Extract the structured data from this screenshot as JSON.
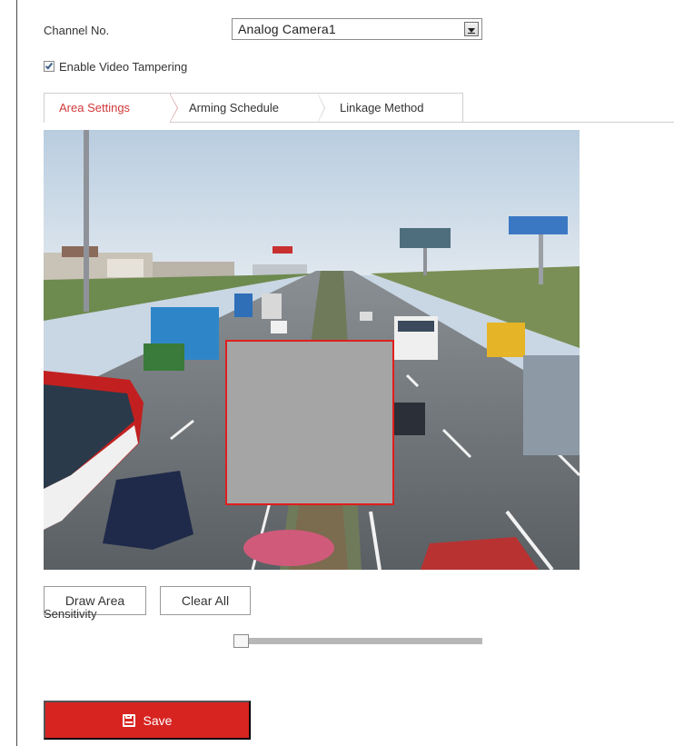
{
  "form": {
    "channel_label": "Channel No.",
    "channel_value": "Analog Camera1",
    "enable_tampering_label": "Enable Video Tampering",
    "enable_tampering_checked": true
  },
  "tabs": [
    {
      "label": "Area Settings",
      "active": true
    },
    {
      "label": "Arming Schedule",
      "active": false
    },
    {
      "label": "Linkage Method",
      "active": false
    }
  ],
  "video": {
    "content": "highway traffic camera view",
    "mask_color": "#a5a5a5",
    "mask_border_color": "#e01e1e"
  },
  "buttons": {
    "draw_area": "Draw Area",
    "clear_all": "Clear All",
    "save": "Save"
  },
  "sensitivity": {
    "label": "Sensitivity",
    "level": 0
  },
  "colors": {
    "accent": "#d72421",
    "active_tab_text": "#d23a3a"
  },
  "icons": {
    "save": "floppy-disk-icon",
    "dropdown": "chevron-down-icon",
    "checkbox": "checkmark-icon"
  }
}
